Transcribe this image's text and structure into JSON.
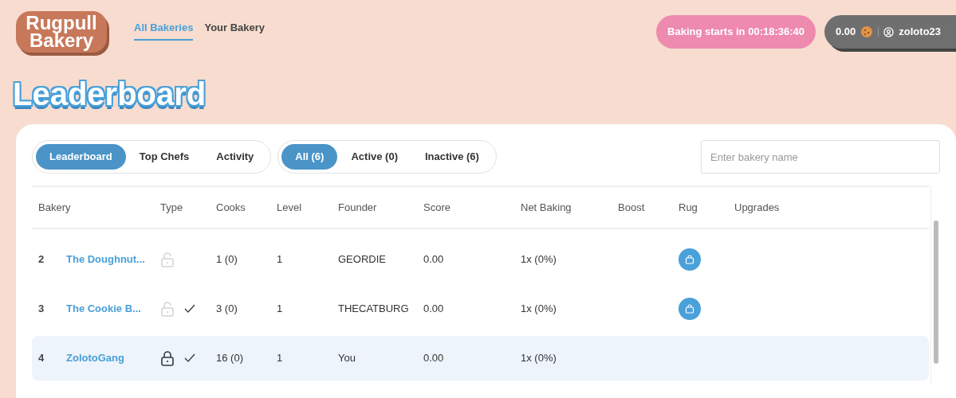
{
  "logo": {
    "line1": "Rugpull",
    "line2": "Bakery"
  },
  "nav": [
    {
      "label": "All Bakeries",
      "selected": true
    },
    {
      "label": "Your Bakery",
      "selected": false
    }
  ],
  "countdown": "Baking starts in 00:18:36:40",
  "account": {
    "balance": "0.00",
    "username": "zoloto23"
  },
  "page_title": "Leaderboard",
  "view_tabs": [
    {
      "label": "Leaderboard",
      "selected": true
    },
    {
      "label": "Top Chefs",
      "selected": false
    },
    {
      "label": "Activity",
      "selected": false
    }
  ],
  "filter_tabs": [
    {
      "label": "All (6)",
      "selected": true
    },
    {
      "label": "Active (0)",
      "selected": false
    },
    {
      "label": "Inactive (6)",
      "selected": false
    }
  ],
  "search": {
    "placeholder": "Enter bakery name"
  },
  "table": {
    "columns": [
      "Bakery",
      "Type",
      "Cooks",
      "Level",
      "Founder",
      "Score",
      "Net Baking",
      "Boost",
      "Rug",
      "Upgrades"
    ],
    "rows": [
      {
        "rank": "2",
        "name": "The Doughnut...",
        "locked": false,
        "checked": false,
        "cooks": "1 (0)",
        "level": "1",
        "founder": "GEORDIE",
        "score": "0.00",
        "net_baking": "1x (0%)",
        "rug_available": true,
        "selected": false
      },
      {
        "rank": "3",
        "name": "The Cookie B...",
        "locked": false,
        "checked": true,
        "cooks": "3 (0)",
        "level": "1",
        "founder": "THECATBURG",
        "score": "0.00",
        "net_baking": "1x (0%)",
        "rug_available": true,
        "selected": false
      },
      {
        "rank": "4",
        "name": "ZolotoGang",
        "locked": true,
        "checked": true,
        "cooks": "16 (0)",
        "level": "1",
        "founder": "You",
        "score": "0.00",
        "net_baking": "1x (0%)",
        "rug_available": false,
        "selected": true
      }
    ]
  }
}
